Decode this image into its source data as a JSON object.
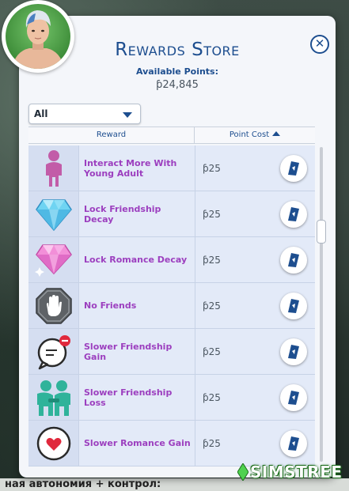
{
  "store": {
    "title": "Rewards Store",
    "available_points_label": "Available Points:",
    "available_points_value": "ƥ24,845",
    "close_label": "✕"
  },
  "filter": {
    "selected": "All"
  },
  "columns": {
    "reward": "Reward",
    "point_cost": "Point Cost"
  },
  "rewards": [
    {
      "name": "Interact More With Young Adult",
      "cost": "ƥ25",
      "icon": "young-adult-figure-icon"
    },
    {
      "name": "Lock Friendship Decay",
      "cost": "ƥ25",
      "icon": "blue-diamond-icon"
    },
    {
      "name": "Lock Romance Decay",
      "cost": "ƥ25",
      "icon": "pink-diamond-icon"
    },
    {
      "name": "No Friends",
      "cost": "ƥ25",
      "icon": "stop-hand-icon"
    },
    {
      "name": "Slower Friendship Gain",
      "cost": "ƥ25",
      "icon": "speech-bubble-minus-icon"
    },
    {
      "name": "Slower Friendship Loss",
      "cost": "ƥ25",
      "icon": "two-friends-icon"
    },
    {
      "name": "Slower Romance Gain",
      "cost": "ƥ25",
      "icon": "heart-circle-icon"
    }
  ],
  "watermark": {
    "text": "SIMSTREE",
    "small_text": "THE"
  },
  "background_text": "ная автономия + контрол:",
  "colors": {
    "title_blue": "#1d4e8f",
    "reward_purple": "#9c3fbf",
    "row_bg": "#e3eaf8"
  }
}
